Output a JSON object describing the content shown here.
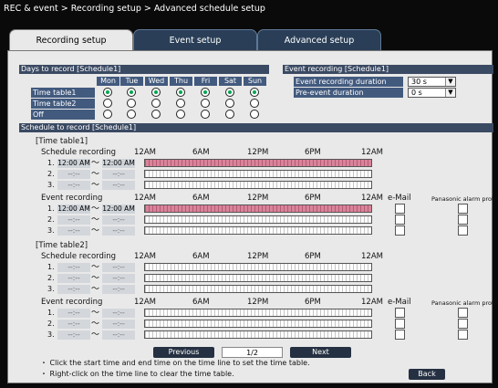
{
  "title": "REC & event > Recording setup > Advanced schedule setup",
  "tabs": [
    "Recording setup",
    "Event setup",
    "Advanced setup"
  ],
  "days": {
    "header": "Days to record [Schedule1]",
    "columns": [
      "Mon",
      "Tue",
      "Wed",
      "Thu",
      "Fri",
      "Sat",
      "Sun"
    ],
    "rows": [
      {
        "label": "Time table1",
        "selected": [
          true,
          true,
          true,
          true,
          true,
          true,
          true
        ]
      },
      {
        "label": "Time table2",
        "selected": [
          false,
          false,
          false,
          false,
          false,
          false,
          false
        ]
      },
      {
        "label": "Off",
        "selected": [
          false,
          false,
          false,
          false,
          false,
          false,
          false
        ]
      }
    ]
  },
  "event_rec": {
    "header": "Event recording [Schedule1]",
    "duration_label": "Event recording duration",
    "duration_value": "30 s",
    "pre_label": "Pre-event duration",
    "pre_value": "0 s"
  },
  "schedule": {
    "header": "Schedule to record [Schedule1]",
    "ticks": [
      "12AM",
      "6AM",
      "12PM",
      "6PM",
      "12AM"
    ],
    "email_label": "e-Mail",
    "alarm_label": "Panasonic alarm protocol",
    "tt1": {
      "title": "[Time table1]",
      "sched_label": "Schedule recording",
      "event_label": "Event recording",
      "sched_rows": [
        {
          "num": "1.",
          "start": "12:00 AM",
          "end": "12:00 AM"
        },
        {
          "num": "2.",
          "start": "--:--",
          "end": "--:--"
        },
        {
          "num": "3.",
          "start": "--:--",
          "end": "--:--"
        }
      ],
      "event_rows": [
        {
          "num": "1.",
          "start": "12:00 AM",
          "end": "12:00 AM"
        },
        {
          "num": "2.",
          "start": "--:--",
          "end": "--:--"
        },
        {
          "num": "3.",
          "start": "--:--",
          "end": "--:--"
        }
      ]
    },
    "tt2": {
      "title": "[Time table2]",
      "sched_label": "Schedule recording",
      "event_label": "Event recording",
      "sched_rows": [
        {
          "num": "1.",
          "start": "--:--",
          "end": "--:--"
        },
        {
          "num": "2.",
          "start": "--:--",
          "end": "--:--"
        },
        {
          "num": "3.",
          "start": "--:--",
          "end": "--:--"
        }
      ],
      "event_rows": [
        {
          "num": "1.",
          "start": "--:--",
          "end": "--:--"
        },
        {
          "num": "2.",
          "start": "--:--",
          "end": "--:--"
        },
        {
          "num": "3.",
          "start": "--:--",
          "end": "--:--"
        }
      ]
    },
    "tilde": "～"
  },
  "pagination": {
    "previous": "Previous",
    "page": "1/2",
    "next": "Next"
  },
  "notes": [
    "・ Click the start time and end time on the time line to set the time table.",
    "・ Right-click on the time line to clear the time table."
  ],
  "back": "Back"
}
